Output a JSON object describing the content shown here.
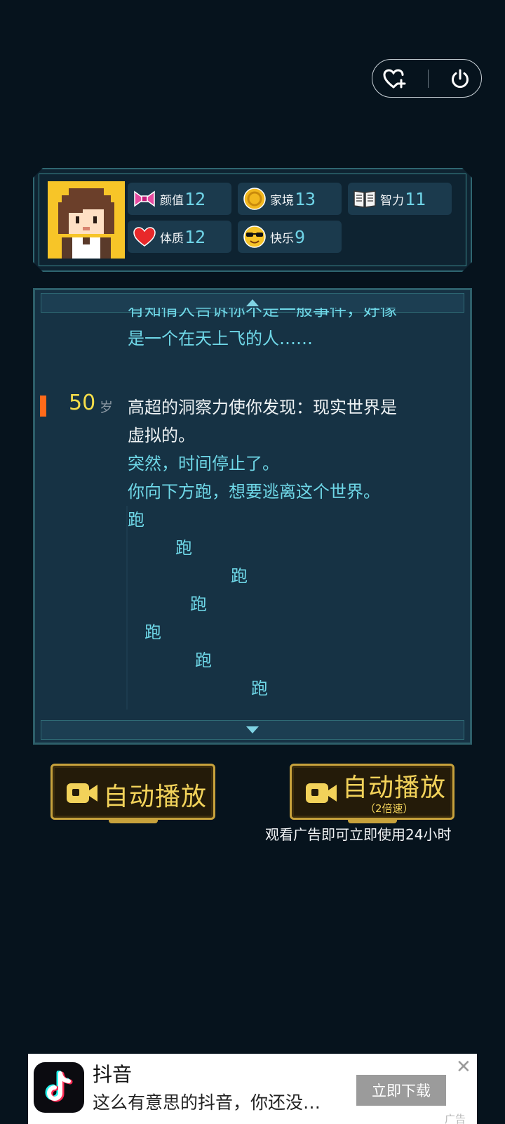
{
  "stats": [
    {
      "key": "appearance",
      "label": "颜值",
      "value": "12",
      "icon": "bow-icon"
    },
    {
      "key": "family",
      "label": "家境",
      "value": "13",
      "icon": "coin-icon"
    },
    {
      "key": "intelligence",
      "label": "智力",
      "value": "11",
      "icon": "book-icon"
    },
    {
      "key": "physique",
      "label": "体质",
      "value": "12",
      "icon": "heart-icon"
    },
    {
      "key": "happiness",
      "label": "快乐",
      "value": "9",
      "icon": "sunglasses-icon"
    }
  ],
  "log": {
    "prev_line_1": "有知情人告诉你不是一般事件，好像",
    "prev_line_2": "是一个在天上飞的人……",
    "age": "50",
    "age_unit": "岁",
    "event_line_1": "高超的洞察力使你发现：现实世界是",
    "event_line_2": "虚拟的。",
    "cyan_line_1": "突然，时间停止了。",
    "cyan_line_2": "你向下方跑，想要逃离这个世界。",
    "run_words": [
      "跑",
      "跑",
      "跑",
      "跑",
      "跑",
      "跑",
      "跑"
    ]
  },
  "buttons": {
    "autoplay_label": "自动播放",
    "autoplay2x_label": "自动播放",
    "autoplay2x_sub": "（2倍速）",
    "watch_note": "观看广告即可立即使用24小时"
  },
  "ad": {
    "app_name": "抖音",
    "description": "这么有意思的抖音，你还没…",
    "download_label": "立即下载",
    "close": "✕",
    "tag": "广告"
  },
  "colors": {
    "background": "#06131d",
    "panel": "#163244",
    "accent_cyan": "#6fd8e8",
    "age_yellow": "#f6de4a",
    "marker_orange": "#ff6a1a",
    "gold": "#c7a23c"
  }
}
